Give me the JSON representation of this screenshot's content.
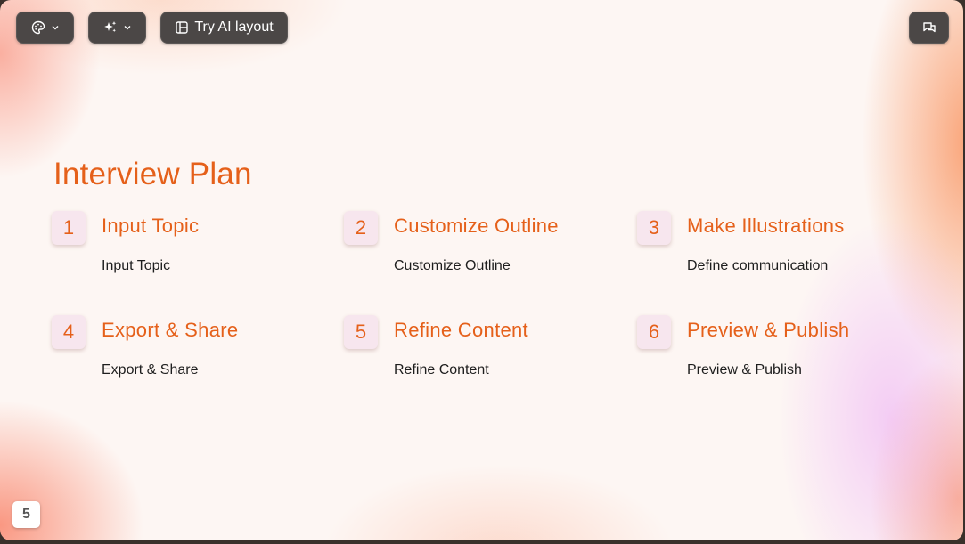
{
  "toolbar": {
    "theme_icon": "palette-icon",
    "ai_icon": "sparkles-icon",
    "layout_icon": "layout-icon",
    "layout_label": "Try AI layout",
    "comment_icon": "comments-icon",
    "chevron_icon": "chevron-down-icon"
  },
  "slide": {
    "title": "Interview Plan",
    "steps": [
      {
        "number": "1",
        "heading": "Input Topic",
        "description": "Input Topic"
      },
      {
        "number": "2",
        "heading": "Customize Outline",
        "description": "Customize Outline"
      },
      {
        "number": "3",
        "heading": "Make Illustrations",
        "description": "Define communication"
      },
      {
        "number": "4",
        "heading": "Export & Share",
        "description": "Export & Share"
      },
      {
        "number": "5",
        "heading": "Refine Content",
        "description": "Refine Content"
      },
      {
        "number": "6",
        "heading": "Preview & Publish",
        "description": "Preview & Publish"
      }
    ],
    "page_number": "5"
  },
  "colors": {
    "accent": "#e5601a",
    "badge_bg": "#f7e6ee",
    "toolbar_bg": "#4b4746"
  }
}
